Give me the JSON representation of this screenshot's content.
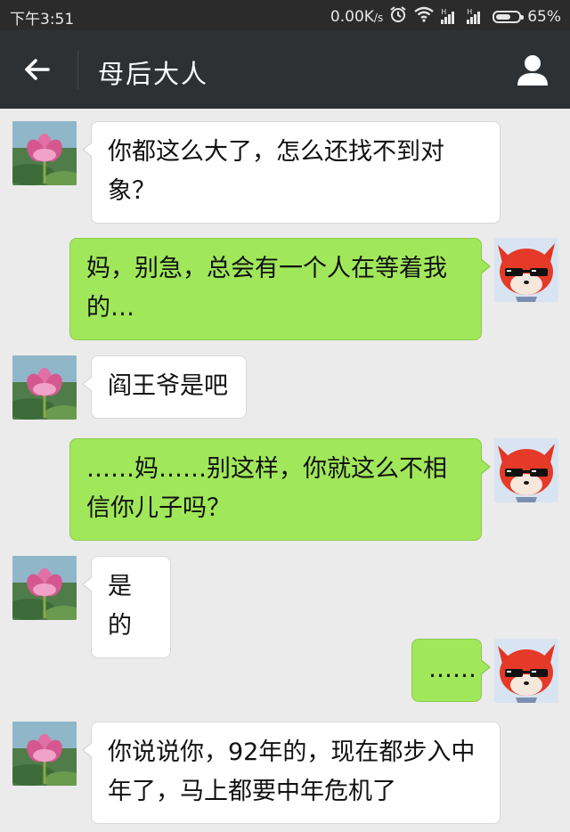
{
  "status_bar": {
    "time": "下午3:51",
    "network_speed": "0.00K",
    "network_unit": "/s",
    "battery": "65%",
    "battery_level": 0.65,
    "icons": [
      "alarm-icon",
      "wifi-icon",
      "signal-icon",
      "signal-icon",
      "battery-icon"
    ]
  },
  "header": {
    "title": "母后大人",
    "back_icon": "back-arrow-icon",
    "profile_icon": "profile-icon"
  },
  "colors": {
    "status_bar_bg": "#2b2b2b",
    "header_bg": "#2e3133",
    "chat_bg": "#ebebeb",
    "incoming_bubble": "#ffffff",
    "outgoing_bubble": "#a0e75a"
  },
  "messages": [
    {
      "from": "incoming",
      "avatar": "lotus-avatar",
      "text": "你都这么大了，怎么还找不到对象？"
    },
    {
      "from": "outgoing",
      "avatar": "red-fox-avatar",
      "text": "妈，别急，总会有一个人在等着我的…"
    },
    {
      "from": "incoming",
      "avatar": "lotus-avatar",
      "text": "阎王爷是吧"
    },
    {
      "from": "outgoing",
      "avatar": "red-fox-avatar",
      "text": "……妈……别这样，你就这么不相信你儿子吗？"
    },
    {
      "from": "incoming",
      "avatar": "lotus-avatar",
      "text": "是的"
    },
    {
      "from": "outgoing",
      "avatar": "red-fox-avatar",
      "text": "……"
    },
    {
      "from": "incoming",
      "avatar": "lotus-avatar",
      "text": "你说说你，92年的，现在都步入中年了，马上都要中年危机了"
    }
  ]
}
